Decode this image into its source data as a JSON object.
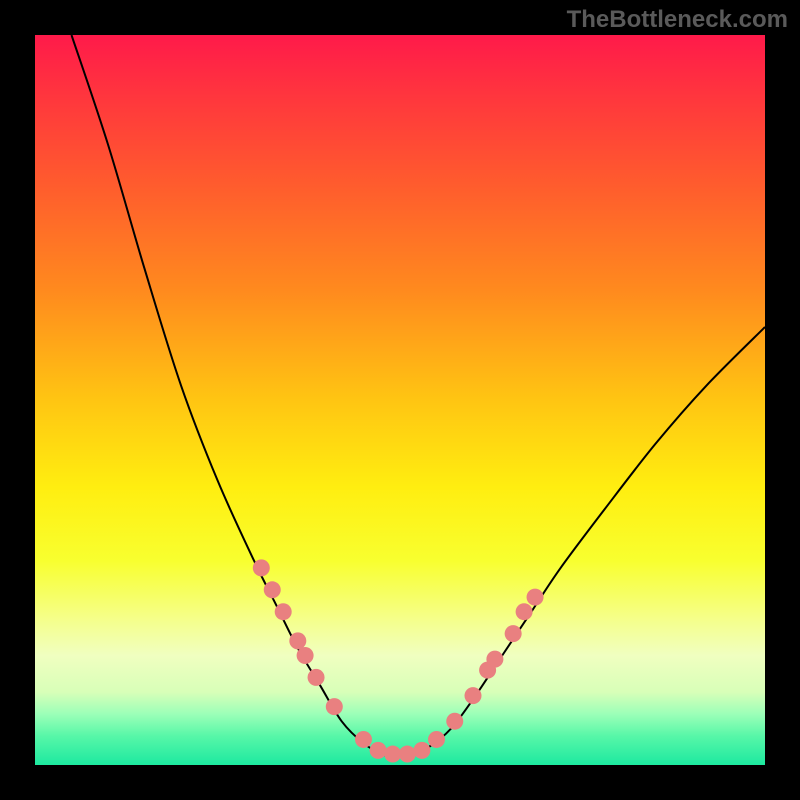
{
  "watermark": "TheBottleneck.com",
  "chart_data": {
    "type": "line",
    "title": "",
    "xlabel": "",
    "ylabel": "",
    "xlim": [
      0,
      100
    ],
    "ylim": [
      0,
      100
    ],
    "curve": [
      {
        "x": 5,
        "y": 100
      },
      {
        "x": 10,
        "y": 85
      },
      {
        "x": 15,
        "y": 68
      },
      {
        "x": 20,
        "y": 52
      },
      {
        "x": 25,
        "y": 39
      },
      {
        "x": 30,
        "y": 28
      },
      {
        "x": 33,
        "y": 22
      },
      {
        "x": 36,
        "y": 16
      },
      {
        "x": 39,
        "y": 11
      },
      {
        "x": 42,
        "y": 6
      },
      {
        "x": 45,
        "y": 3
      },
      {
        "x": 48,
        "y": 1.3
      },
      {
        "x": 51,
        "y": 1.3
      },
      {
        "x": 54,
        "y": 2.5
      },
      {
        "x": 57,
        "y": 5
      },
      {
        "x": 60,
        "y": 9
      },
      {
        "x": 64,
        "y": 15
      },
      {
        "x": 68,
        "y": 21
      },
      {
        "x": 72,
        "y": 27
      },
      {
        "x": 78,
        "y": 35
      },
      {
        "x": 85,
        "y": 44
      },
      {
        "x": 92,
        "y": 52
      },
      {
        "x": 100,
        "y": 60
      }
    ],
    "dots": [
      {
        "x": 31,
        "y": 27
      },
      {
        "x": 32.5,
        "y": 24
      },
      {
        "x": 34,
        "y": 21
      },
      {
        "x": 36,
        "y": 17
      },
      {
        "x": 37,
        "y": 15
      },
      {
        "x": 38.5,
        "y": 12
      },
      {
        "x": 41,
        "y": 8
      },
      {
        "x": 45,
        "y": 3.5
      },
      {
        "x": 47,
        "y": 2
      },
      {
        "x": 49,
        "y": 1.5
      },
      {
        "x": 51,
        "y": 1.5
      },
      {
        "x": 53,
        "y": 2
      },
      {
        "x": 55,
        "y": 3.5
      },
      {
        "x": 57.5,
        "y": 6
      },
      {
        "x": 60,
        "y": 9.5
      },
      {
        "x": 62,
        "y": 13
      },
      {
        "x": 63,
        "y": 14.5
      },
      {
        "x": 65.5,
        "y": 18
      },
      {
        "x": 67,
        "y": 21
      },
      {
        "x": 68.5,
        "y": 23
      }
    ],
    "colors": {
      "gradient_top": "#ff1a4a",
      "gradient_bottom": "#1de9a0",
      "curve": "#000000",
      "dot": "#e98080"
    }
  }
}
